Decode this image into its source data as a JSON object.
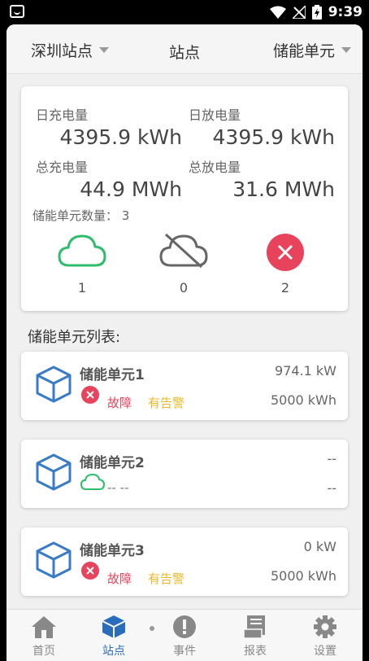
{
  "status_bar": {
    "time": "9:39"
  },
  "header": {
    "site_selector": "深圳站点",
    "title": "站点",
    "unit_selector": "储能单元"
  },
  "summary": {
    "daily_charge": {
      "label": "日充电量",
      "value": "4395.9 kWh"
    },
    "daily_discharge": {
      "label": "日放电量",
      "value": "4395.9 kWh"
    },
    "total_charge": {
      "label": "总充电量",
      "value": "44.9 MWh"
    },
    "total_discharge": {
      "label": "总放电量",
      "value": "31.6 MWh"
    },
    "unit_count_label": "储能单元数量：",
    "unit_count": "3",
    "online_count": "1",
    "offline_count": "0",
    "fault_count": "2"
  },
  "list_title": "储能单元列表:",
  "units": [
    {
      "name": "储能单元1",
      "power": "974.1 kW",
      "energy": "5000 kWh",
      "fault": "故障",
      "alarm": "有告警"
    },
    {
      "name": "储能单元2",
      "power": "--",
      "energy": "--",
      "dash": "--   --"
    },
    {
      "name": "储能单元3",
      "power": "0 kW",
      "energy": "5000 kWh",
      "fault": "故障",
      "alarm": "有告警"
    }
  ],
  "tabs": [
    {
      "label": "首页"
    },
    {
      "label": "站点"
    },
    {
      "label": "事件"
    },
    {
      "label": "报表"
    },
    {
      "label": "设置"
    }
  ],
  "colors": {
    "accent": "#2a6ebb",
    "online": "#2ebd6b",
    "fault": "#e8435d",
    "alarm": "#e8b92a"
  }
}
